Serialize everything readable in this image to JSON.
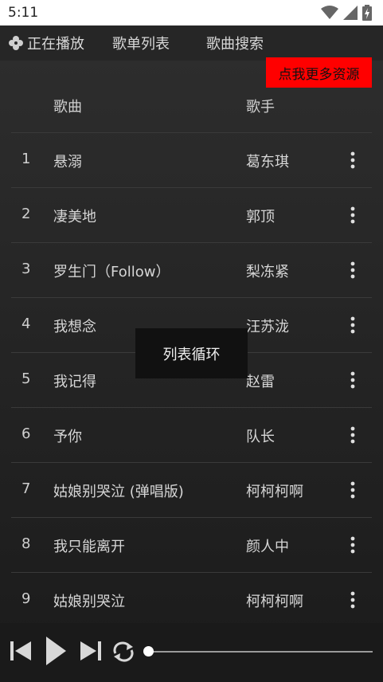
{
  "status": {
    "time": "5:11"
  },
  "tabs": {
    "now_playing": "正在播放",
    "playlist": "歌单列表",
    "search": "歌曲搜索"
  },
  "promo": "点我更多资源",
  "header": {
    "song": "歌曲",
    "artist": "歌手"
  },
  "songs": [
    {
      "no": "1",
      "title": "悬溺",
      "artist": "葛东琪"
    },
    {
      "no": "2",
      "title": "凄美地",
      "artist": "郭顶"
    },
    {
      "no": "3",
      "title": "罗生门（Follow）",
      "artist": "梨冻紧"
    },
    {
      "no": "4",
      "title": "我想念",
      "artist": "汪苏泷"
    },
    {
      "no": "5",
      "title": "我记得",
      "artist": "赵雷"
    },
    {
      "no": "6",
      "title": "予你",
      "artist": "队长"
    },
    {
      "no": "7",
      "title": "姑娘别哭泣 (弹唱版)",
      "artist": "柯柯柯啊"
    },
    {
      "no": "8",
      "title": "我只能离开",
      "artist": "颜人中"
    },
    {
      "no": "9",
      "title": "姑娘别哭泣",
      "artist": "柯柯柯啊"
    }
  ],
  "toast": "列表循环",
  "player": {
    "progress": 0.0
  },
  "icons": {
    "tab_now": "pinwheel-icon",
    "prev": "skip-previous-icon",
    "play": "play-icon",
    "next": "skip-next-icon",
    "repeat": "repeat-icon",
    "more": "more-vertical-icon"
  }
}
